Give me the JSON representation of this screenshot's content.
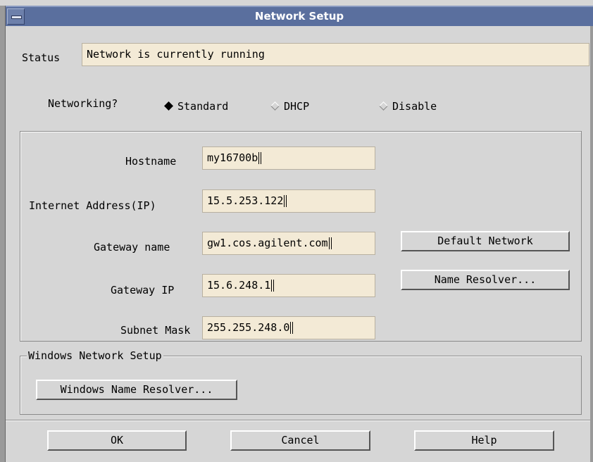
{
  "window": {
    "title": "Network Setup"
  },
  "status": {
    "label": "Status",
    "value": "Network is currently running"
  },
  "networking": {
    "label": "Networking?",
    "options": [
      {
        "label": "Standard",
        "selected": true
      },
      {
        "label": "DHCP",
        "selected": false
      },
      {
        "label": "Disable",
        "selected": false
      }
    ]
  },
  "fields": {
    "hostname": {
      "label": "Hostname",
      "value": "my16700b"
    },
    "ip": {
      "label": "Internet Address(IP)",
      "value": "15.5.253.122"
    },
    "gateway_name": {
      "label": "Gateway name",
      "value": "gw1.cos.agilent.com"
    },
    "gateway_ip": {
      "label": "Gateway IP",
      "value": "15.6.248.1"
    },
    "subnet": {
      "label": "Subnet Mask",
      "value": "255.255.248.0"
    }
  },
  "buttons": {
    "default_network": "Default Network",
    "name_resolver": "Name Resolver...",
    "windows_name_resolver": "Windows Name Resolver...",
    "ok": "OK",
    "cancel": "Cancel",
    "help": "Help"
  },
  "windows_group": {
    "title": "Windows Network Setup"
  },
  "colors": {
    "titlebar": "#5a6f9e",
    "field": "#f3ead6",
    "background": "#d6d6d6"
  }
}
